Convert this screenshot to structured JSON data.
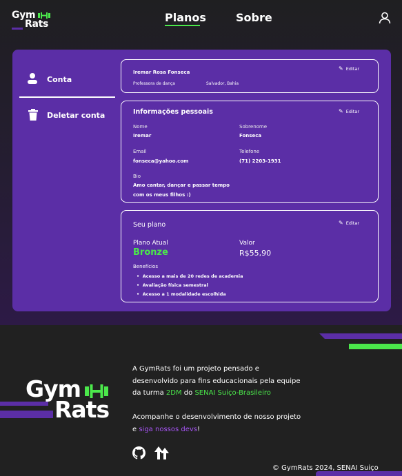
{
  "header": {
    "logo_line1": "Gym",
    "logo_line2": "Rats",
    "nav": [
      {
        "label": "Planos"
      },
      {
        "label": "Sobre"
      }
    ],
    "accent_green": "#4be84b",
    "accent_purple": "#5b2ea6"
  },
  "sidebar": {
    "items": [
      {
        "label": "Conta",
        "icon": "person-icon"
      },
      {
        "label": "Deletar conta",
        "icon": "trash-icon"
      }
    ]
  },
  "profile": {
    "name": "Iremar Rosa Fonseca",
    "role": "Professora de dança",
    "location": "Salvador, Bahia",
    "edit_label": "Editar"
  },
  "personal": {
    "title": "Informações pessoais",
    "edit_label": "Editar",
    "first_name_label": "Nome",
    "first_name": "Iremar",
    "last_name_label": "Sobrenome",
    "last_name": "Fonseca",
    "email_label": "Email",
    "email": "fonseca@yahoo.com",
    "phone_label": "Telefone",
    "phone": "(71) 2203-1931",
    "bio_label": "Bio",
    "bio_line1": "Amo cantar, dançar e passar tempo",
    "bio_line2": "com os meus filhos :)"
  },
  "plan": {
    "title": "Seu plano",
    "edit_label": "Editar",
    "current_label": "Plano Atual",
    "current": "Bronze",
    "price_label": "Valor",
    "price": "R$55,90",
    "benefits_label": "Benefícios",
    "benefits": [
      "Acesso a mais de 20 redes de academia",
      "Avaliação física semestral",
      "Acesso a 1 modalidade escolhida"
    ]
  },
  "footer": {
    "logo_line1": "Gym",
    "logo_line2": "Rats",
    "about_line1": "A GymRats foi um projeto pensado e",
    "about_line2": "desenvolvido para fins educacionais pela equipe",
    "about_line3_a": "da turma ",
    "about_line3_turma": "2DM",
    "about_line3_b": " do ",
    "about_line3_school": "SENAI Suiço-Brasileiro",
    "follow_line1": "Acompanhe o desenvolvimento de nosso projeto",
    "follow_line2_a": "e ",
    "follow_line2_link": "siga nossos devs",
    "follow_line2_b": "!",
    "social_icons": [
      "github-icon",
      "upload-arrows-icon"
    ],
    "copyright": "© GymRats 2024, SENAI Suiço"
  }
}
